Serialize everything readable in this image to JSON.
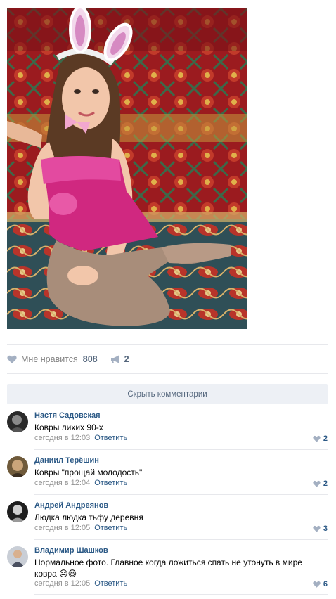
{
  "post": {
    "likes_label": "Мне нравится",
    "likes_count": "808",
    "shares_count": "2",
    "hide_comments": "Скрыть комментарии"
  },
  "comments": [
    {
      "author": "Настя Садовская",
      "text": "Ковры лихих 90-х",
      "time": "сегодня в 12:03",
      "reply": "Ответить",
      "likes": "2"
    },
    {
      "author": "Даниил Терёшин",
      "text": "Ковры \"прощай молодость\"",
      "time": "сегодня в 12:04",
      "reply": "Ответить",
      "likes": "2"
    },
    {
      "author": "Андрей Андреянов",
      "text": "Людка людка тьфу деревня",
      "time": "сегодня в 12:05",
      "reply": "Ответить",
      "likes": "3"
    },
    {
      "author": "Владимир Шашков",
      "text": "Нормальное фото. Главное когда ложиться спать не утонуть в мире ковра 😑😆",
      "time": "сегодня в 12:05",
      "reply": "Ответить",
      "likes": "6"
    }
  ],
  "colors": {
    "link": "#2a5885",
    "meta": "#939393",
    "button_bg": "#edf0f5"
  }
}
